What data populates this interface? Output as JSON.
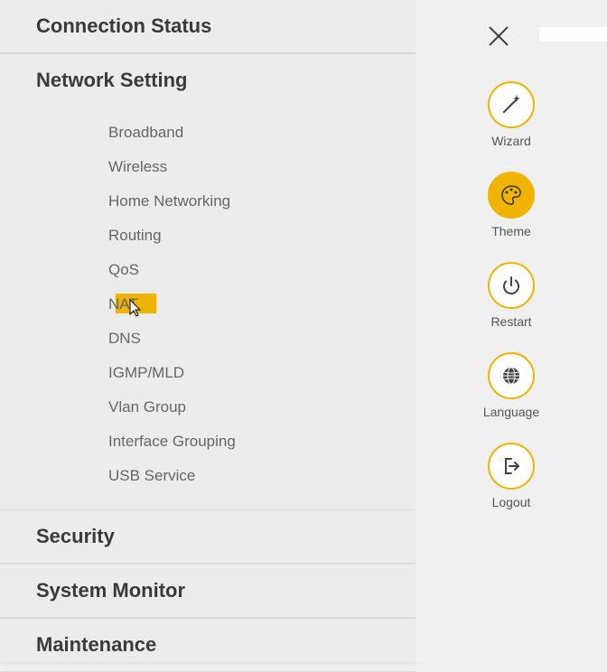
{
  "sections": {
    "connection": "Connection Status",
    "network": "Network Setting",
    "security": "Security",
    "system_monitor": "System Monitor",
    "maintenance": "Maintenance"
  },
  "network_items": {
    "broadband": "Broadband",
    "wireless": "Wireless",
    "home_networking": "Home Networking",
    "routing": "Routing",
    "qos": "QoS",
    "nat": "NAT",
    "dns": "DNS",
    "igmp_mld": "IGMP/MLD",
    "vlan_group": "Vlan Group",
    "interface_grouping": "Interface Grouping",
    "usb_service": "USB Service"
  },
  "actions": {
    "wizard": "Wizard",
    "theme": "Theme",
    "restart": "Restart",
    "language": "Language",
    "logout": "Logout"
  },
  "colors": {
    "accent": "#f0b400",
    "text_dark": "#3a3a3a",
    "text_light": "#666"
  }
}
